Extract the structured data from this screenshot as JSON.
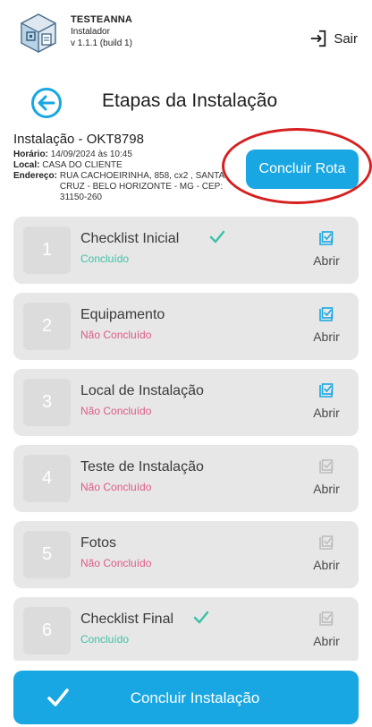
{
  "app": {
    "name": "TESTEANNA",
    "role": "Instalador",
    "version": "v 1.1.1 (build 1)"
  },
  "header": {
    "logout_label": "Sair"
  },
  "page": {
    "title": "Etapas da Instalação"
  },
  "installation": {
    "title": "Instalação - OKT8798",
    "time_label": "Horário:",
    "time_value": "14/09/2024 às 10:45",
    "place_label": "Local:",
    "place_value": "CASA DO CLIENTE",
    "address_label": "Endereço:",
    "address_value": "RUA CACHOEIRINHA, 858, cx2 , SANTA CRUZ - BELO HORIZONTE - MG - CEP: 31150-260"
  },
  "route_button": {
    "label": "Concluir Rota"
  },
  "steps": [
    {
      "number": "1",
      "name": "Checklist Inicial",
      "status": "Concluído",
      "done": true,
      "action": "Abrir",
      "action_enabled": true
    },
    {
      "number": "2",
      "name": "Equipamento",
      "status": "Não Concluído",
      "done": false,
      "action": "Abrir",
      "action_enabled": true
    },
    {
      "number": "3",
      "name": "Local de Instalação",
      "status": "Não Concluído",
      "done": false,
      "action": "Abrir",
      "action_enabled": true
    },
    {
      "number": "4",
      "name": "Teste de Instalação",
      "status": "Não Concluído",
      "done": false,
      "action": "Abrir",
      "action_enabled": false
    },
    {
      "number": "5",
      "name": "Fotos",
      "status": "Não Concluído",
      "done": false,
      "action": "Abrir",
      "action_enabled": false
    },
    {
      "number": "6",
      "name": "Checklist Final",
      "status": "Concluído",
      "done": true,
      "action": "Abrir",
      "action_enabled": false
    }
  ],
  "finish_button": {
    "label": "Concluir Instalação"
  },
  "colors": {
    "accent": "#19a7e3",
    "done": "#3fc1a8",
    "pending": "#e05b84",
    "highlight_circle": "#d61f1f"
  },
  "icons": {
    "logo": "app-logo-icon",
    "logout": "logout-icon",
    "back": "back-arrow-icon",
    "done_check": "check-icon",
    "open": "checkbox-icon",
    "finish": "check-icon"
  }
}
